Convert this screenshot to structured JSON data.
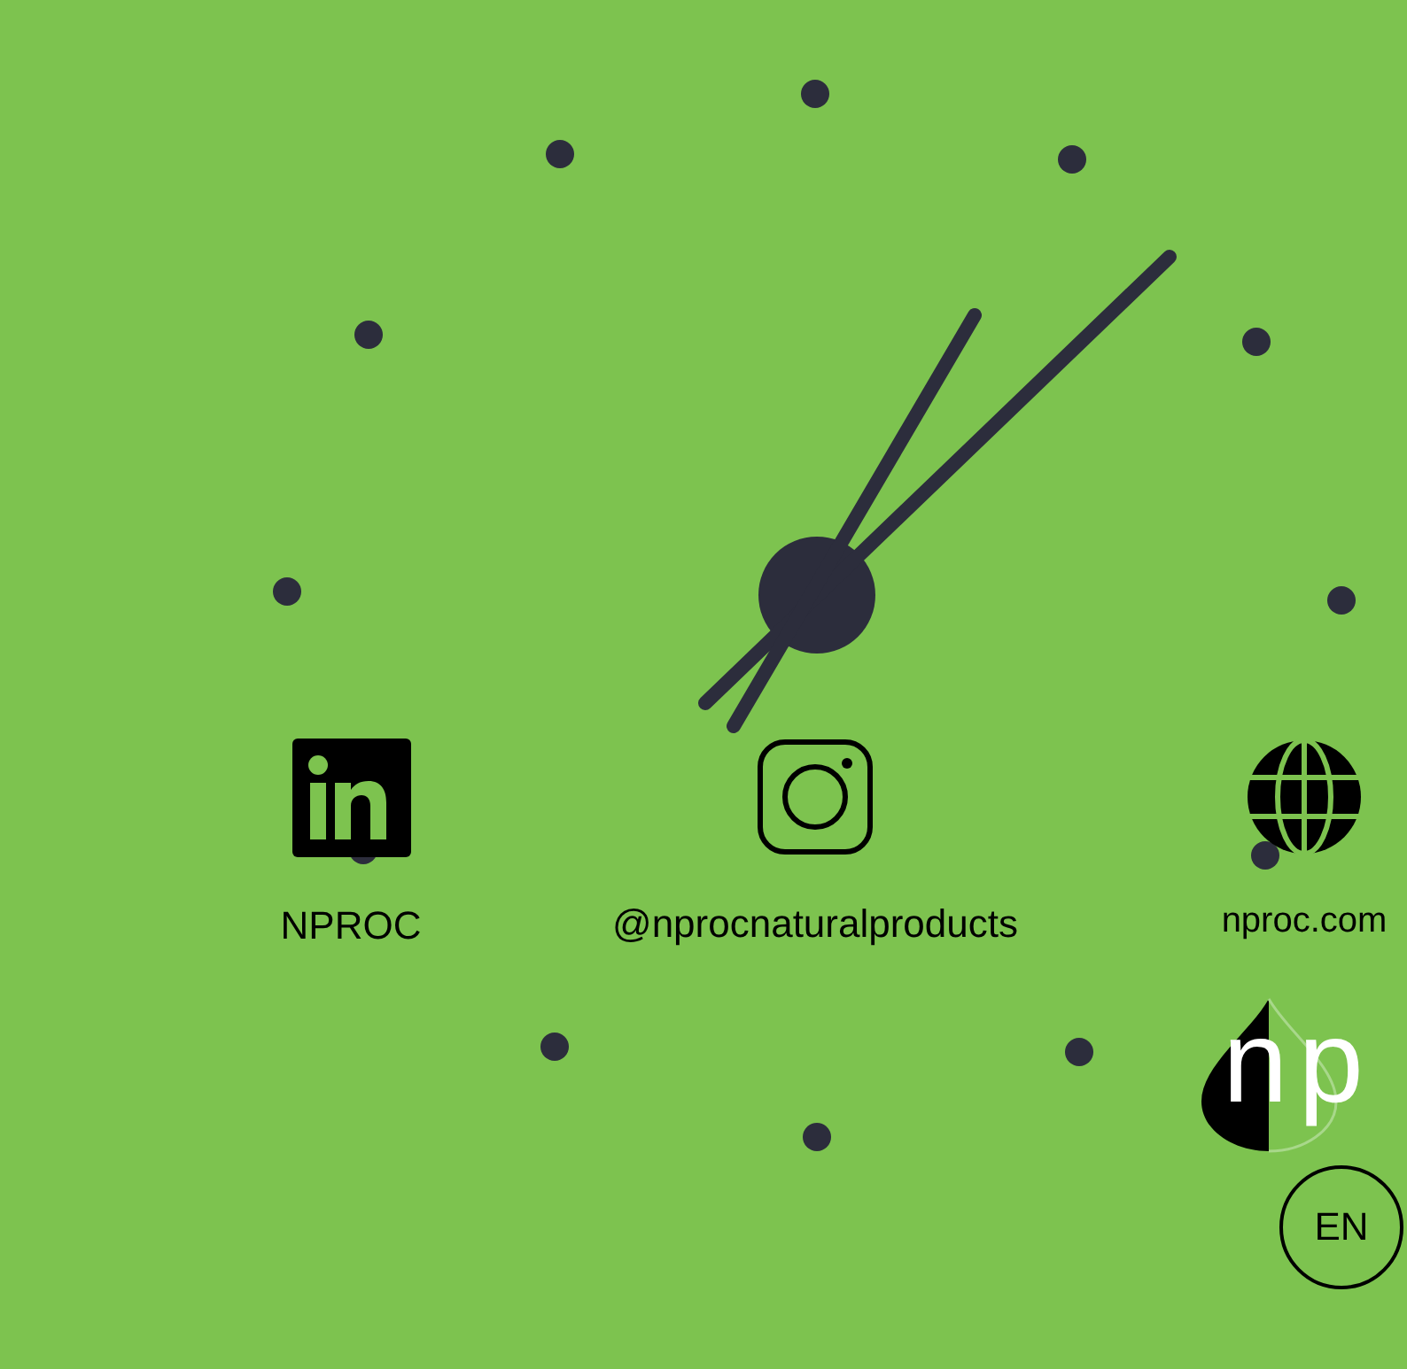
{
  "social_links": [
    {
      "kind": "linkedin",
      "label": "NPROC"
    },
    {
      "kind": "instagram",
      "label": "@nprocnaturalproducts"
    },
    {
      "kind": "web",
      "label": "nproc.com"
    }
  ],
  "logo": {
    "text": "np"
  },
  "language_button": {
    "label": "EN"
  }
}
